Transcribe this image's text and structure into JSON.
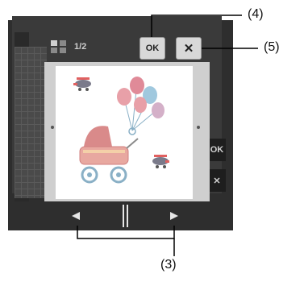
{
  "top_bar": {
    "page_indicator": "1/2",
    "ok_label": "OK"
  },
  "side_buttons": {
    "ok_label": "OK"
  },
  "callouts": {
    "ok": "(4)",
    "close": "(5)",
    "nav": "(3)"
  },
  "icons": {
    "page_icon": "pages-icon",
    "close": "close-icon",
    "prev": "triangle-left-icon",
    "next": "triangle-right-icon",
    "pause": "pause-icon"
  },
  "colors": {
    "device": "#2e2e2e",
    "button_face": "#d8d8d8",
    "card": "#ffffff"
  }
}
